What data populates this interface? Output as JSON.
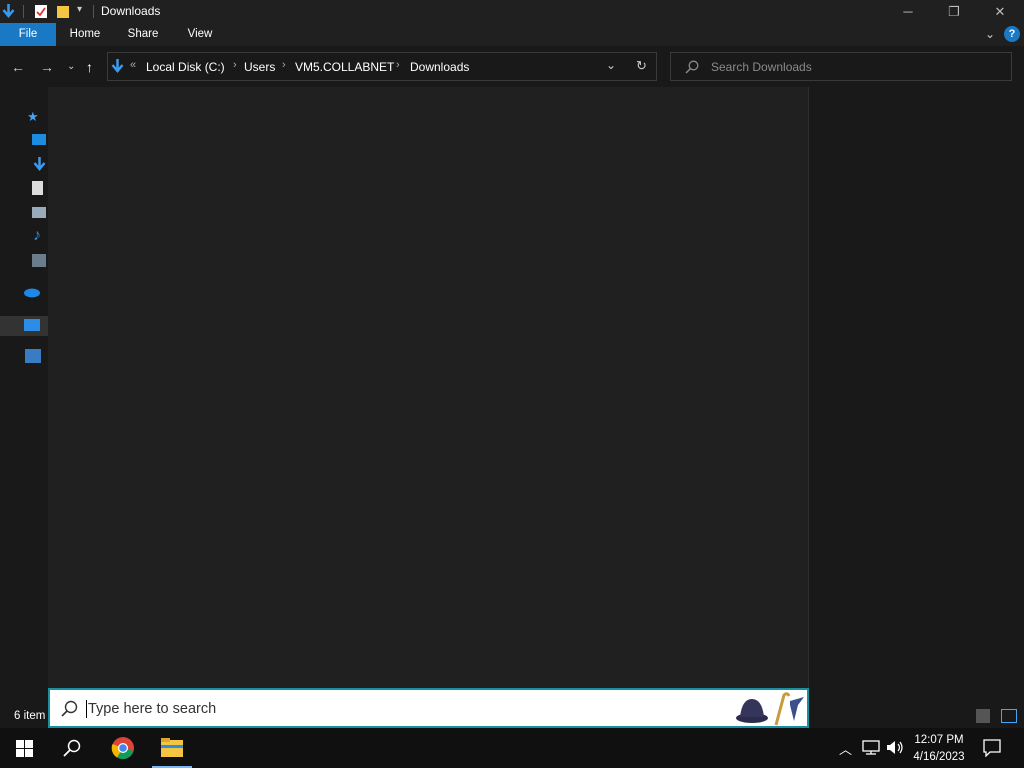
{
  "window": {
    "title": "Downloads",
    "minimize_label": "─",
    "restore_label": "❐",
    "close_label": "✕"
  },
  "ribbon": {
    "tabs": [
      {
        "label": "File"
      },
      {
        "label": "Home"
      },
      {
        "label": "Share"
      },
      {
        "label": "View"
      }
    ],
    "help_label": "?"
  },
  "address": {
    "crumbs": [
      "Local Disk (C:)",
      "Users",
      "VM5.COLLABNET",
      "Downloads"
    ],
    "overflow": "«"
  },
  "search": {
    "placeholder": "Search Downloads"
  },
  "status": {
    "item_count": "6 item"
  },
  "start_search": {
    "placeholder": "Type here to search"
  },
  "taskbar": {
    "time": "12:07 PM",
    "date": "4/16/2023"
  },
  "colors": {
    "accent": "#1a79c4",
    "search_border": "#1a8fa0",
    "background": "#191919"
  }
}
